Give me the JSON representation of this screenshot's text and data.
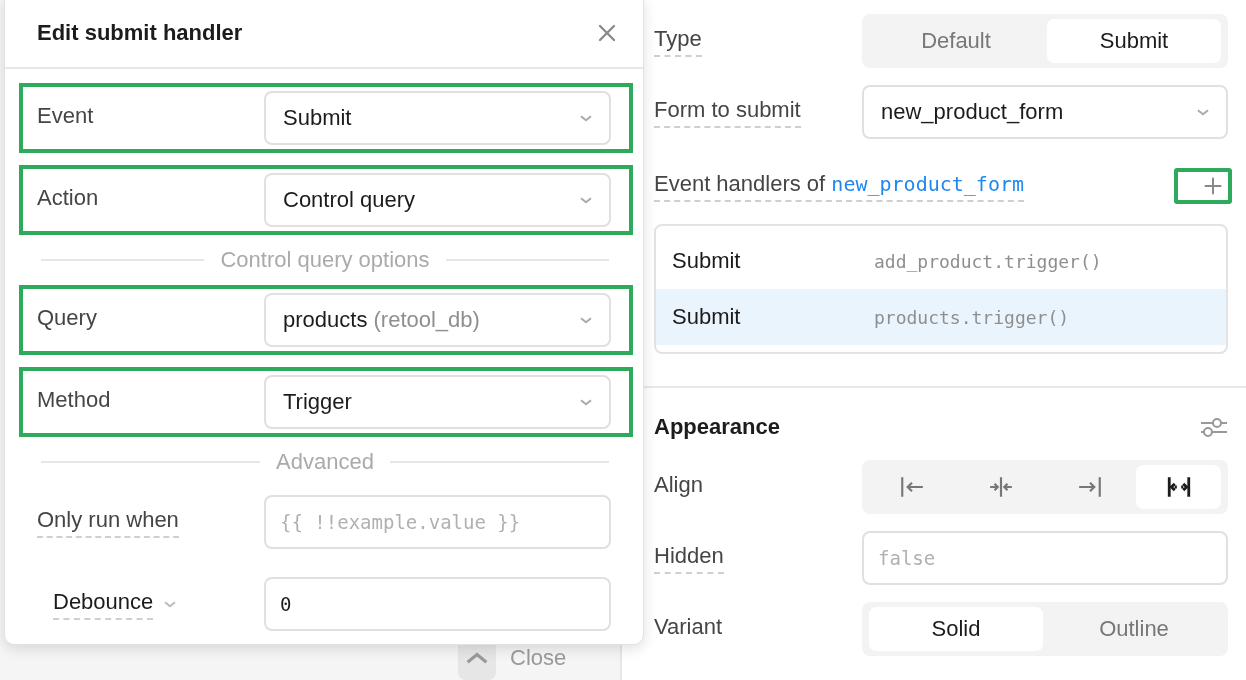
{
  "background": {
    "close_button": "Close"
  },
  "dialog": {
    "title": "Edit submit handler",
    "items": [
      {
        "kind": "select",
        "label": "Event",
        "value": "Submit",
        "highlighted": true
      },
      {
        "kind": "select",
        "label": "Action",
        "value": "Control query",
        "highlighted": true
      },
      {
        "kind": "divider",
        "label": "Control query options"
      },
      {
        "kind": "select",
        "label": "Query",
        "value": "products",
        "detail": "(retool_db)",
        "highlighted": true
      },
      {
        "kind": "select",
        "label": "Method",
        "value": "Trigger",
        "highlighted": true
      },
      {
        "kind": "divider",
        "label": "Advanced"
      },
      {
        "kind": "input",
        "label": "Only run when",
        "placeholder": "{{ !!example.value }}",
        "highlighted": false
      },
      {
        "kind": "dropdown_input",
        "label": "Debounce",
        "value": "0",
        "highlighted": false
      }
    ]
  },
  "inspector": {
    "rows": [
      {
        "kind": "segmented",
        "label": "Type",
        "underlined": true,
        "options": [
          {
            "label": "Default",
            "selected": false
          },
          {
            "label": "Submit",
            "selected": true
          }
        ]
      },
      {
        "kind": "select",
        "label": "Form to submit",
        "underlined": true,
        "value": "new_product_form"
      }
    ],
    "handlers": {
      "label": "Event handlers of",
      "target": "new_product_form",
      "add_highlighted": true,
      "items": [
        {
          "event": "Submit",
          "action": "add_product.trigger()",
          "selected": false
        },
        {
          "event": "Submit",
          "action": "products.trigger()",
          "selected": true
        }
      ]
    },
    "appearance": {
      "title": "Appearance",
      "rows": [
        {
          "kind": "icon_segmented",
          "label": "Align",
          "underlined": false,
          "options": [
            {
              "kind": "left",
              "selected": false
            },
            {
              "kind": "center",
              "selected": false
            },
            {
              "kind": "right",
              "selected": false
            },
            {
              "kind": "stretch",
              "selected": true
            }
          ]
        },
        {
          "kind": "input",
          "label": "Hidden",
          "underlined": true,
          "placeholder": "false"
        },
        {
          "kind": "segmented",
          "label": "Variant",
          "underlined": false,
          "options": [
            {
              "label": "Solid",
              "selected": true
            },
            {
              "label": "Outline",
              "selected": false
            }
          ]
        }
      ]
    }
  }
}
